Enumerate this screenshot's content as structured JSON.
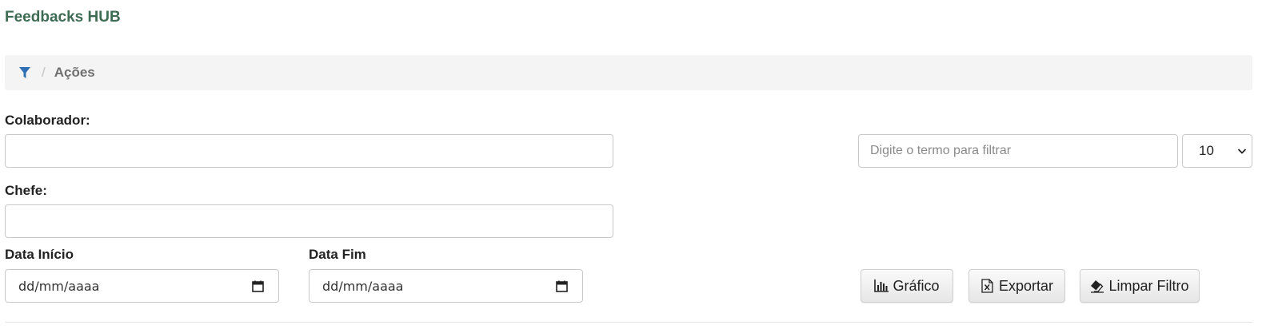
{
  "app": {
    "title": "Feedbacks HUB"
  },
  "breadcrumb": {
    "separator": "/",
    "current": "Ações"
  },
  "form": {
    "colaborador": {
      "label": "Colaborador:",
      "value": ""
    },
    "chefe": {
      "label": "Chefe:",
      "value": ""
    },
    "data_inicio": {
      "label": "Data Início",
      "value": "dd/mm/aaaa"
    },
    "data_fim": {
      "label": "Data Fim",
      "value": "dd/mm/aaaa"
    }
  },
  "filter": {
    "placeholder": "Digite o termo para filtrar"
  },
  "page_size": {
    "selected": "10"
  },
  "buttons": {
    "grafico": "Gráfico",
    "exportar": "Exportar",
    "limpar": "Limpar Filtro"
  },
  "colors": {
    "title": "#3d6b53",
    "breadcrumb_bg": "#f4f4f4",
    "filter_icon": "#2f6fb3"
  },
  "icons": {
    "breadcrumb": "filter-icon",
    "date": "calendar-icon",
    "grafico": "bar-chart-icon",
    "exportar": "excel-file-icon",
    "limpar": "eraser-icon",
    "select": "chevron-down-icon"
  }
}
